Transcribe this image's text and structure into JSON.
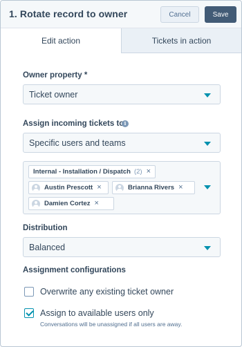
{
  "header": {
    "title": "1. Rotate record to owner",
    "cancel_label": "Cancel",
    "save_label": "Save"
  },
  "tabs": [
    {
      "label": "Edit action",
      "active": true
    },
    {
      "label": "Tickets in action",
      "active": false
    }
  ],
  "owner_property": {
    "label": "Owner property *",
    "value": "Ticket owner"
  },
  "assign_to": {
    "label": "Assign incoming tickets to",
    "info_icon": "info-icon",
    "value": "Specific users and teams"
  },
  "assignees": {
    "team": {
      "name": "Internal - Installation / Dispatch",
      "count": "(2)"
    },
    "users": [
      "Austin Prescott",
      "Brianna Rivers",
      "Damien Cortez"
    ],
    "remove_glyph": "×"
  },
  "distribution": {
    "label": "Distribution",
    "value": "Balanced"
  },
  "assignment_configurations": {
    "label": "Assignment configurations",
    "options": [
      {
        "label": "Overwrite any existing ticket owner",
        "checked": false
      },
      {
        "label": "Assign to available users only",
        "checked": true
      }
    ],
    "helper": "Conversations will be unassigned if all users are away."
  },
  "colors": {
    "accent": "#0091ae",
    "primary_button": "#425b76",
    "text": "#33475b",
    "border": "#cbd6e2"
  }
}
